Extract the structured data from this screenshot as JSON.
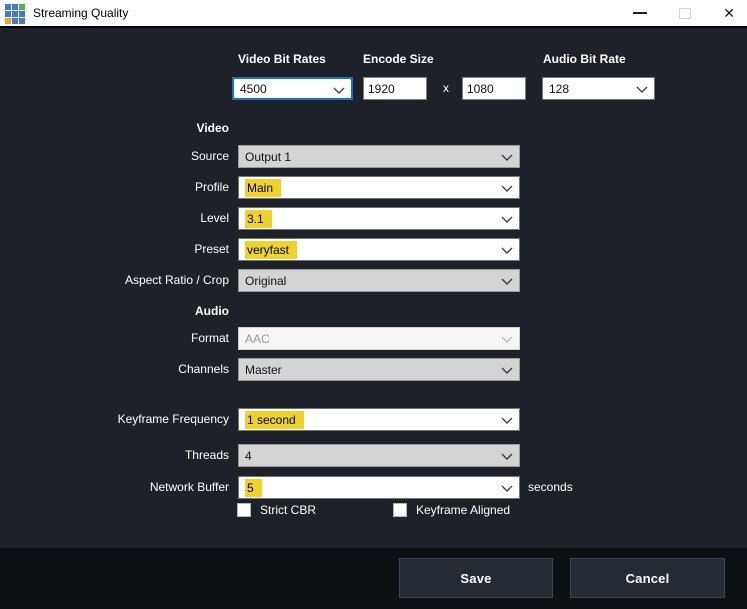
{
  "window": {
    "title": "Streaming Quality",
    "close_glyph": "✕"
  },
  "top_row": {
    "video_bit_rates_label": "Video Bit Rates",
    "video_bit_rates_value": "4500",
    "encode_size_label": "Encode Size",
    "encode_width": "1920",
    "encode_separator": "x",
    "encode_height": "1080",
    "audio_bit_rate_label": "Audio Bit Rate",
    "audio_bit_rate_value": "128"
  },
  "video_section": {
    "header": "Video",
    "source_label": "Source",
    "source_value": "Output 1",
    "profile_label": "Profile",
    "profile_value": "Main",
    "level_label": "Level",
    "level_value": "3.1",
    "preset_label": "Preset",
    "preset_value": "veryfast",
    "aspect_label": "Aspect Ratio / Crop",
    "aspect_value": "Original"
  },
  "audio_section": {
    "header": "Audio",
    "format_label": "Format",
    "format_value": "AAC",
    "channels_label": "Channels",
    "channels_value": "Master"
  },
  "advanced": {
    "keyframe_label": "Keyframe Frequency",
    "keyframe_value": "1 second",
    "threads_label": "Threads",
    "threads_value": "4",
    "network_buffer_label": "Network Buffer",
    "network_buffer_value": "5",
    "network_buffer_suffix": "seconds",
    "strict_cbr_label": "Strict CBR",
    "keyframe_aligned_label": "Keyframe Aligned"
  },
  "footer": {
    "save_label": "Save",
    "cancel_label": "Cancel"
  },
  "colors": {
    "highlight": "#efd32a",
    "focus_border": "#1a73c7",
    "body_bg": "#1e2228",
    "footer_bg": "#0d1013",
    "button_bg": "#262b33",
    "dd_gray": "#d4d4d4",
    "icon_blue": "#3f7dc0",
    "icon_green": "#52b15c",
    "icon_orange": "#f09d3a"
  }
}
